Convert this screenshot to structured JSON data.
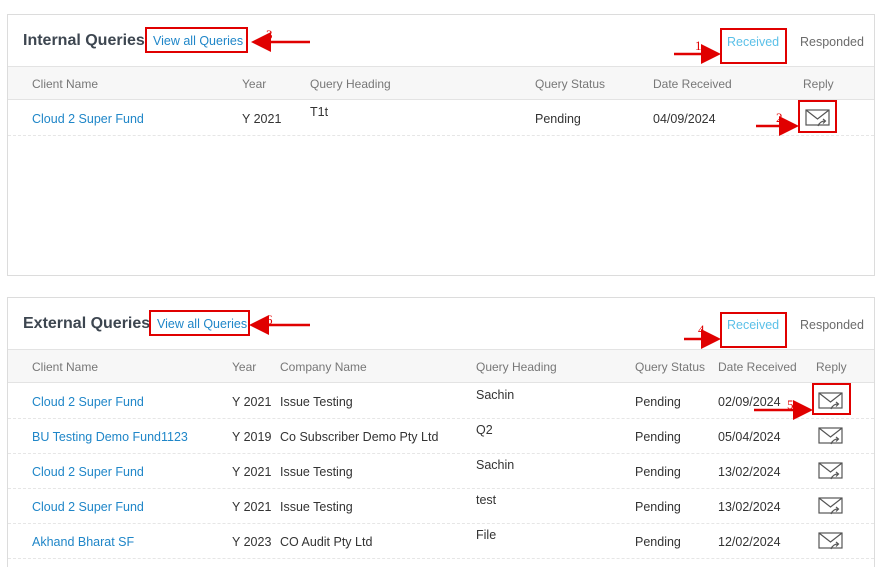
{
  "internal": {
    "title": "Internal Queries",
    "view_all": "View all Queries",
    "tabs": {
      "received": "Received",
      "responded": "Responded"
    },
    "columns": [
      "Client Name",
      "Year",
      "Query Heading",
      "Query Status",
      "Date Received",
      "Reply"
    ],
    "rows": [
      {
        "client": "Cloud 2 Super Fund",
        "year": "Y 2021",
        "heading": "T1t",
        "status": "Pending",
        "date": "04/09/2024"
      }
    ]
  },
  "external": {
    "title": "External Queries",
    "view_all": "View all Queries",
    "tabs": {
      "received": "Received",
      "responded": "Responded"
    },
    "columns": [
      "Client Name",
      "Year",
      "Company Name",
      "Query Heading",
      "Query Status",
      "Date Received",
      "Reply"
    ],
    "rows": [
      {
        "client": "Cloud 2 Super Fund",
        "year": "Y 2021",
        "company": "Issue Testing",
        "heading": "Sachin",
        "status": "Pending",
        "date": "02/09/2024"
      },
      {
        "client": "BU Testing Demo Fund1123",
        "year": "Y 2019",
        "company": "Co Subscriber Demo Pty Ltd",
        "heading": "Q2",
        "status": "Pending",
        "date": "05/04/2024"
      },
      {
        "client": "Cloud 2 Super Fund",
        "year": "Y 2021",
        "company": "Issue Testing",
        "heading": "Sachin",
        "status": "Pending",
        "date": "13/02/2024"
      },
      {
        "client": "Cloud 2 Super Fund",
        "year": "Y 2021",
        "company": "Issue Testing",
        "heading": "test",
        "status": "Pending",
        "date": "13/02/2024"
      },
      {
        "client": "Akhand Bharat SF",
        "year": "Y 2023",
        "company": "CO Audit Pty Ltd",
        "heading": "File",
        "status": "Pending",
        "date": "12/02/2024"
      }
    ]
  },
  "annotations": [
    "1",
    "2",
    "3",
    "4",
    "5",
    "6"
  ],
  "icons": {
    "reply": "mail-reply-icon"
  },
  "colors": {
    "link": "#1f86c8",
    "active_tab": "#5bc0e8",
    "annotation": "#e00000"
  }
}
